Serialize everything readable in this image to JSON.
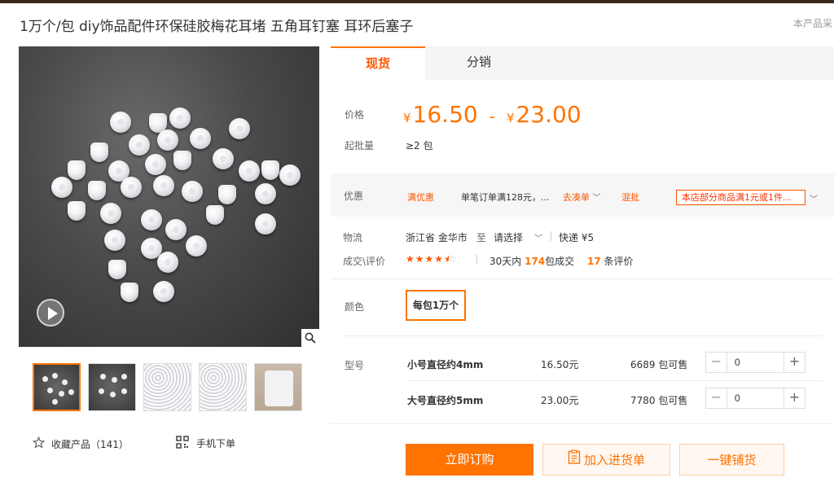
{
  "page": {
    "title": "1万个/包 diy饰品配件环保硅胶梅花耳堵 五角耳钉塞 耳环后塞子",
    "top_right_note": "本产品采"
  },
  "gallery": {
    "favorite_label": "收藏产品（141）",
    "mobile_order_label": "手机下单"
  },
  "tabs": [
    {
      "label": "现货",
      "active": true
    },
    {
      "label": "分销",
      "active": false
    }
  ],
  "price": {
    "label": "价格",
    "currency": "¥",
    "low": "16.50",
    "high": "23.00",
    "separator": "-"
  },
  "min_order": {
    "label": "起批量",
    "value": "≥2 包"
  },
  "promotion": {
    "label": "优惠",
    "tag": "满优惠",
    "text": "单笔订单满128元，...",
    "link": "去凑单",
    "mix_tag": "混批",
    "notice": "本店部分商品满1元或1件..."
  },
  "logistics": {
    "label": "物流",
    "origin": "浙江省 金华市",
    "to": "至",
    "destination": "请选择",
    "shipping": "快递 ¥5"
  },
  "reviews": {
    "label": "成交\\评价",
    "rating": 4.5,
    "sold_prefix": "30天内",
    "sold_count": "174",
    "sold_suffix": "包成交",
    "review_count": "17",
    "review_suffix": "条评价"
  },
  "color": {
    "label": "颜色",
    "option": "每包1万个"
  },
  "model": {
    "label": "型号",
    "rows": [
      {
        "name": "小号直径约4mm",
        "price": "16.50元",
        "stock": "6689 包可售",
        "qty": "0"
      },
      {
        "name": "大号直径约5mm",
        "price": "23.00元",
        "stock": "7780 包可售",
        "qty": "0"
      }
    ]
  },
  "actions": {
    "buy_now": "立即订购",
    "add_to_cart": "加入进货单",
    "one_click": "一键铺货"
  },
  "colors": {
    "accent": "#ff7300",
    "accent_dark": "#ff5500"
  }
}
